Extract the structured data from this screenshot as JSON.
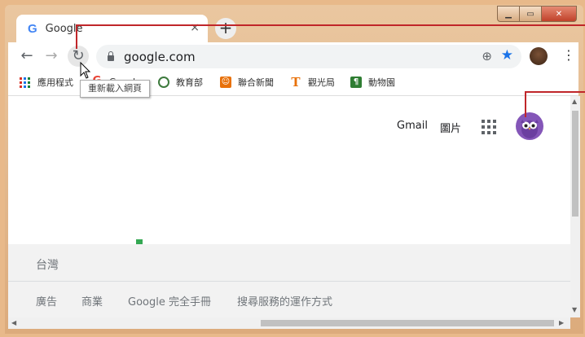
{
  "window": {
    "min_icon": "minimize-icon",
    "max_icon": "maximize-icon",
    "close_label": "✕"
  },
  "tab": {
    "title": "Google",
    "close_label": "×",
    "new_tab_label": "+"
  },
  "toolbar": {
    "url": "google.com"
  },
  "bookmarks": [
    {
      "label": "應用程式",
      "icon": "apps-grid-icon"
    },
    {
      "label": "Google",
      "icon": "google-g-icon"
    },
    {
      "label": "教育部",
      "icon": "moe-logo-icon"
    },
    {
      "label": "聯合新聞",
      "icon": "udn-icon"
    },
    {
      "label": "觀光局",
      "icon": "t-icon"
    },
    {
      "label": "動物園",
      "icon": "zoo-icon"
    }
  ],
  "tooltip": {
    "text": "重新載入網頁"
  },
  "page": {
    "gmail": "Gmail",
    "images": "圖片",
    "footer_country": "台灣",
    "footer_links": [
      "廣告",
      "商業",
      "Google 完全手冊",
      "搜尋服務的運作方式"
    ]
  },
  "colors": {
    "accent": "#1a73e8",
    "callout": "#c0262a",
    "avatar_bg": "#8456b8"
  }
}
